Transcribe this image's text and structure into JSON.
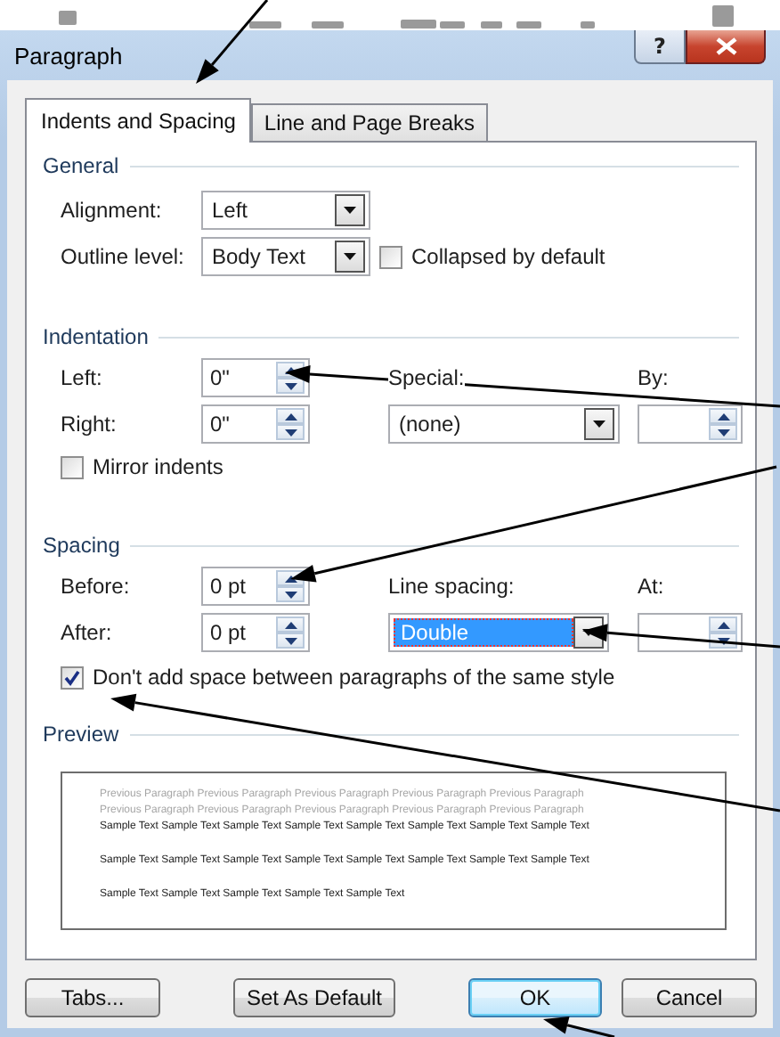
{
  "window": {
    "title": "Paragraph",
    "help": "?"
  },
  "tabs": [
    {
      "label": "Indents and Spacing",
      "selected": true
    },
    {
      "label": "Line and Page Breaks",
      "selected": false
    }
  ],
  "general": {
    "title": "General",
    "alignment": {
      "label": "Alignment:",
      "value": "Left"
    },
    "outline_level": {
      "label": "Outline level:",
      "value": "Body Text"
    },
    "collapsed": {
      "label": "Collapsed by default",
      "checked": false
    }
  },
  "indentation": {
    "title": "Indentation",
    "left": {
      "label": "Left:",
      "value": "0\""
    },
    "right": {
      "label": "Right:",
      "value": "0\""
    },
    "special": {
      "label": "Special:",
      "value": "(none)"
    },
    "by": {
      "label": "By:"
    },
    "mirror": {
      "label": "Mirror indents",
      "checked": false
    }
  },
  "spacing": {
    "title": "Spacing",
    "before": {
      "label": "Before:",
      "value": "0 pt"
    },
    "after": {
      "label": "After:",
      "value": "0 pt"
    },
    "line_spacing": {
      "label": "Line spacing:",
      "value": "Double",
      "highlighted": true
    },
    "at": {
      "label": "At:"
    },
    "dont_add": {
      "label": "Don't add space between paragraphs of the same style",
      "checked": true
    }
  },
  "preview": {
    "title": "Preview",
    "lines": [
      {
        "kind": "previous",
        "text": "Previous Paragraph Previous Paragraph Previous Paragraph Previous Paragraph Previous Paragraph"
      },
      {
        "kind": "previous",
        "text": "Previous Paragraph Previous Paragraph Previous Paragraph Previous Paragraph Previous Paragraph"
      },
      {
        "kind": "sample",
        "text": "Sample Text Sample Text Sample Text Sample Text Sample Text Sample Text Sample Text Sample Text"
      },
      {
        "kind": "sample",
        "text": "Sample Text Sample Text Sample Text Sample Text Sample Text Sample Text Sample Text Sample Text"
      },
      {
        "kind": "sample",
        "text": "Sample Text Sample Text Sample Text Sample Text Sample Text"
      }
    ]
  },
  "buttons": [
    {
      "label": "Tabs...",
      "default": false
    },
    {
      "label": "Set As Default",
      "default": false
    },
    {
      "label": "OK",
      "default": true
    },
    {
      "label": "Cancel",
      "default": false
    }
  ]
}
